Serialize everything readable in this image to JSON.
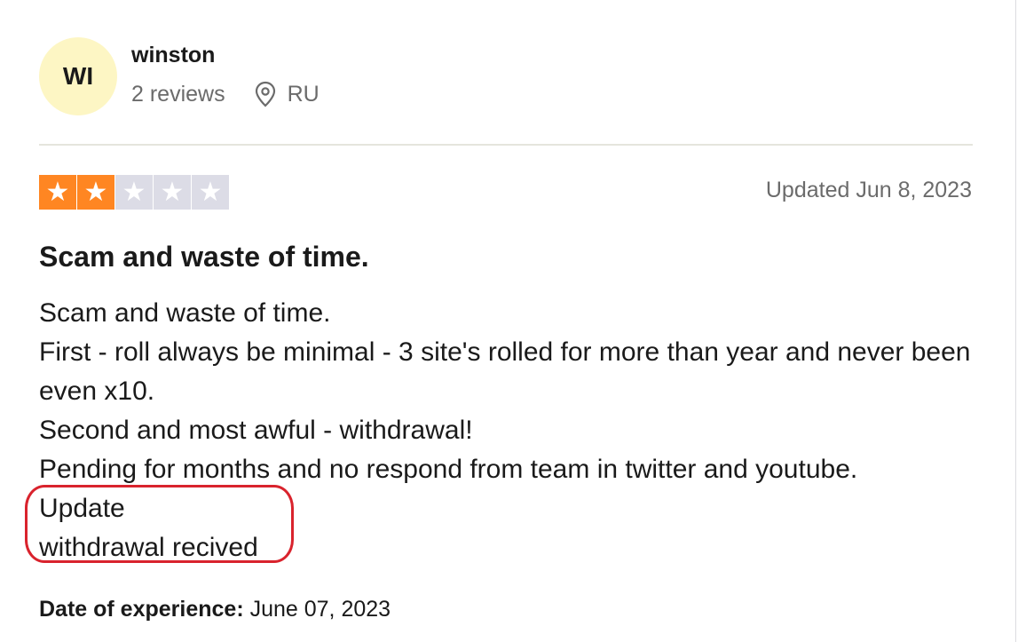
{
  "reviewer": {
    "initials": "WI",
    "name": "winston",
    "review_count": "2 reviews",
    "location_icon": "map-pin-icon",
    "country": "RU"
  },
  "review": {
    "rating": 2,
    "rating_max": 5,
    "star_on_color": "#ff8622",
    "star_off_color": "#dcdce6",
    "updated": "Updated Jun 8, 2023",
    "title": "Scam and waste of time.",
    "lines": [
      "Scam and waste of time.",
      "First - roll always be minimal - 3 site's rolled for more than year and never been even x10.",
      "Second and most awful - withdrawal!",
      "Pending for months and no respond from team in twitter and youtube.",
      "Update",
      "withdrawal recived"
    ],
    "experience_label": "Date of experience:",
    "experience_date": "June 07, 2023"
  },
  "annotation": {
    "ring_color": "#d9232d"
  }
}
